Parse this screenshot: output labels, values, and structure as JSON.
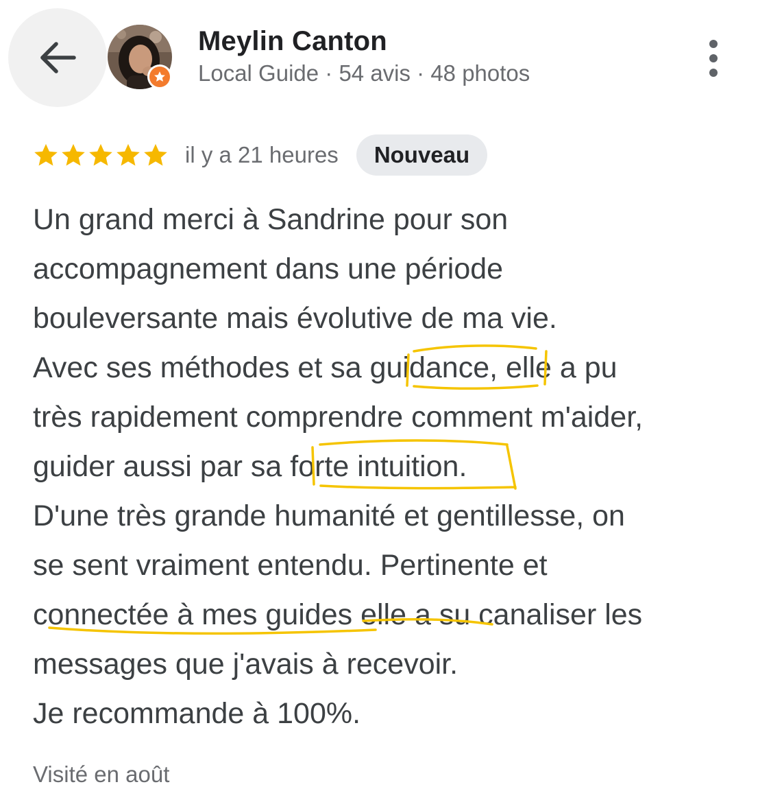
{
  "header": {
    "user_name": "Meylin Canton",
    "user_meta": "Local Guide · 54 avis · 48 photos"
  },
  "icons": {
    "back": "arrow-left-icon",
    "more": "more-vertical-icon",
    "badge": "local-guide-star-icon",
    "star": "star-icon"
  },
  "review": {
    "rating": 5,
    "rating_max": 5,
    "time": "il y a 21 heures",
    "badge": "Nouveau",
    "lines": [
      "Un grand merci à Sandrine pour son",
      "accompagnement dans une période",
      "bouleversante mais évolutive de ma vie.",
      "Avec ses méthodes et sa guidance, elle a pu",
      "très rapidement comprendre comment m'aider,",
      "guider aussi par sa forte intuition.",
      "D'une très grande humanité et gentillesse, on",
      "se sent vraiment entendu. Pertinente et",
      "connectée à mes guides elle a su canaliser les",
      "messages que j'avais à recevoir.",
      "Je recommande à 100%."
    ],
    "visited": "Visité en août"
  },
  "colors": {
    "star": "#f6b800",
    "highlight_pen": "#f5c400",
    "badge_orange": "#f37b2d",
    "back_circle": "#f1f1f1",
    "new_badge_bg": "#e8eaed"
  }
}
